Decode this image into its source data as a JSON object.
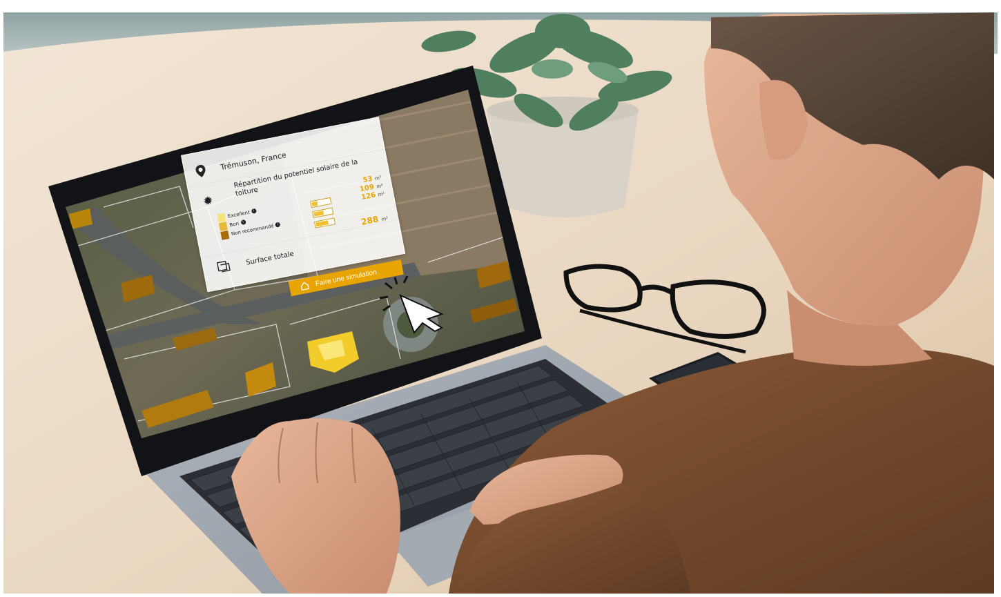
{
  "photo": {
    "caption_elements": [
      "laptop-with-solar-map",
      "man-typing",
      "plant",
      "glasses",
      "smartphone"
    ]
  },
  "app": {
    "location": "Trémuson, France",
    "potential_title": "Répartition du potentiel solaire de la toiture",
    "legend": [
      {
        "label": "Excellent",
        "color": "#f6e27a"
      },
      {
        "label": "Bon",
        "color": "#e7b93a"
      },
      {
        "label": "Non recommandé",
        "color": "#a86e0a"
      }
    ],
    "values": [
      {
        "value": "53",
        "unit": "m²",
        "fill": 0.3
      },
      {
        "value": "109",
        "unit": "m²",
        "fill": 0.55
      },
      {
        "value": "126",
        "unit": "m²",
        "fill": 0.7
      }
    ],
    "total_label": "Surface totale",
    "total_value": "288",
    "total_unit": "m²",
    "simulation_button": "Faire une simulation",
    "icons": [
      "location-pin-icon",
      "sun-icon",
      "info-icon",
      "surface-icon",
      "home-icon",
      "cursor-icon"
    ],
    "accent_color": "#e8a400"
  }
}
